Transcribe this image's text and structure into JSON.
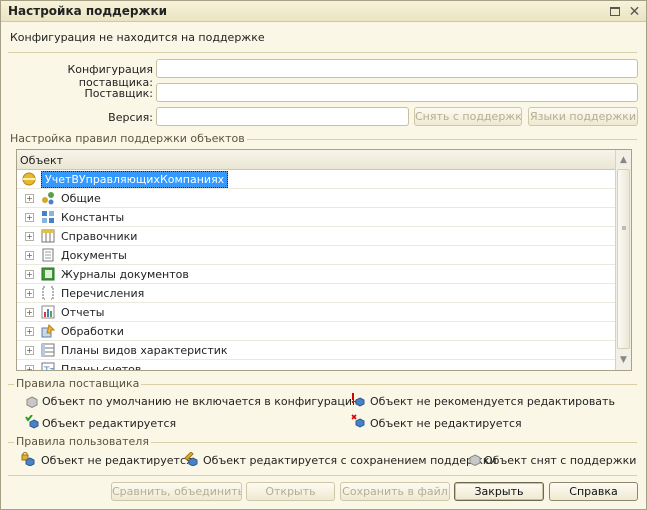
{
  "window": {
    "title": "Настройка поддержки"
  },
  "status": "Конфигурация не находится на поддержке",
  "form": {
    "vendor_config_label": "Конфигурация поставщика:",
    "vendor_label": "Поставщик:",
    "version_label": "Версия:",
    "vendor_config_value": "",
    "vendor_value": "",
    "version_value": "",
    "remove_support_btn": "Снять с поддержки",
    "support_languages_btn": "Языки поддержки"
  },
  "rules_group": {
    "title": "Настройка правил поддержки объектов",
    "column_header": "Объект",
    "root": "УчетВУправляющихКомпаниях",
    "items": [
      {
        "label": "Общие",
        "icon": "common-icon"
      },
      {
        "label": "Константы",
        "icon": "constants-icon"
      },
      {
        "label": "Справочники",
        "icon": "catalogs-icon"
      },
      {
        "label": "Документы",
        "icon": "documents-icon"
      },
      {
        "label": "Журналы документов",
        "icon": "document-journals-icon"
      },
      {
        "label": "Перечисления",
        "icon": "enumerations-icon"
      },
      {
        "label": "Отчеты",
        "icon": "reports-icon"
      },
      {
        "label": "Обработки",
        "icon": "data-processors-icon"
      },
      {
        "label": "Планы видов характеристик",
        "icon": "chart-of-characteristic-types-icon"
      },
      {
        "label": "Планы счетов",
        "icon": "chart-of-accounts-icon"
      }
    ]
  },
  "vendor_rules": {
    "title": "Правила поставщика",
    "not_included": "Объект по умолчанию не включается в конфигурацию",
    "not_recommended": "Объект не рекомендуется редактировать",
    "editable": "Объект редактируется",
    "not_editable": "Объект не редактируется"
  },
  "user_rules": {
    "title": "Правила пользователя",
    "not_editable": "Объект не редактируется",
    "editable_keep_support": "Объект редактируется с сохранением поддержки",
    "removed_from_support": "Объект снят с поддержки"
  },
  "footer": {
    "compare_btn": "Сравнить, объединить",
    "open_btn": "Открыть",
    "save_to_file_btn": "Сохранить в файл",
    "close_btn": "Закрыть",
    "help_btn": "Справка"
  },
  "colors": {
    "window_bg": "#fbf7e6",
    "selection": "#3399ff",
    "disabled_text": "#b5ad92"
  }
}
